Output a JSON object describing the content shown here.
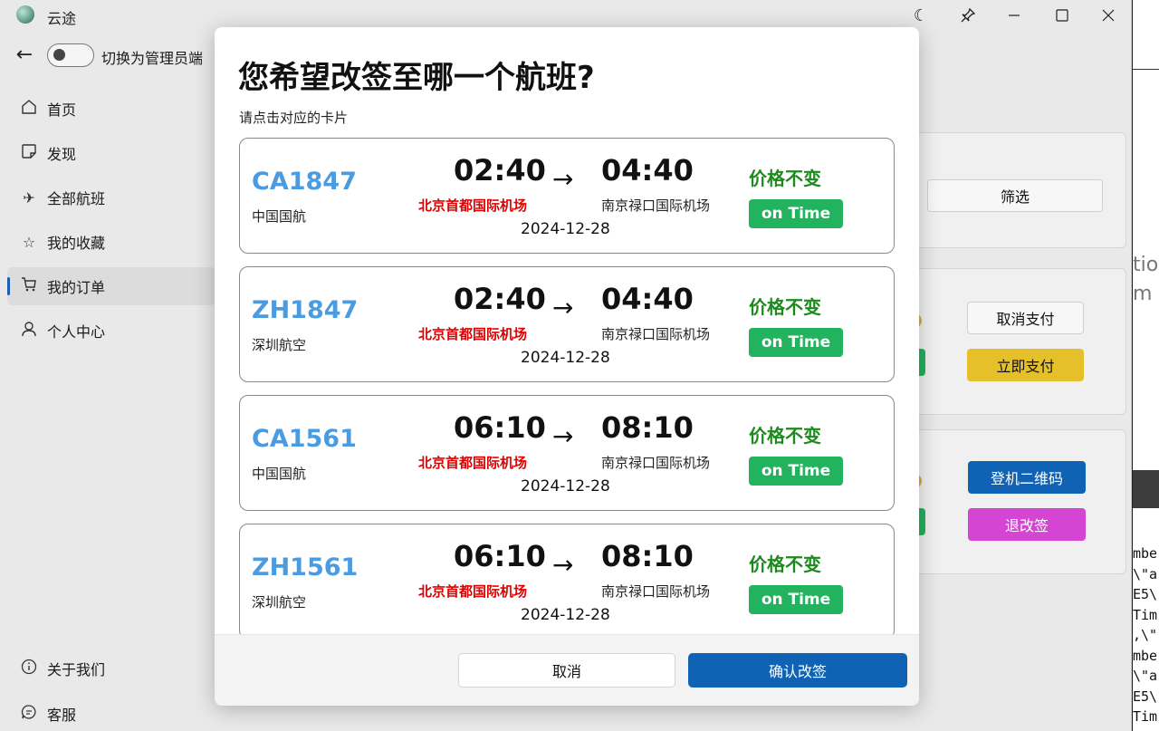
{
  "app": {
    "title": "云途"
  },
  "toggle": {
    "label": "切换为管理员端"
  },
  "nav": {
    "items": [
      {
        "label": "首页",
        "icon": "home-icon"
      },
      {
        "label": "发现",
        "icon": "note-icon"
      },
      {
        "label": "全部航班",
        "icon": "airplane-icon"
      },
      {
        "label": "我的收藏",
        "icon": "star-icon"
      },
      {
        "label": "我的订单",
        "icon": "cart-icon",
        "selected": true
      },
      {
        "label": "个人中心",
        "icon": "person-icon"
      }
    ],
    "bottom": [
      {
        "label": "关于我们",
        "icon": "info-icon"
      },
      {
        "label": "客服",
        "icon": "chat-icon"
      }
    ]
  },
  "background": {
    "filter_label": "筛选",
    "cancel_pay_label": "取消支付",
    "pay_now_label": "立即支付",
    "boarding_qr_label": "登机二维码",
    "refund_change_label": "退改签",
    "terminal_lines": [
      "tio",
      "m",
      "mbe",
      "\\\"a",
      "E5\\",
      "Tim",
      ",\\\"",
      "mbe",
      "\\\"a",
      "E5\\",
      "Tim"
    ]
  },
  "dialog": {
    "title": "您希望改签至哪一个航班?",
    "subtitle": "请点击对应的卡片",
    "arrow": "→",
    "flights": [
      {
        "flight_no": "CA1847",
        "airline": "中国国航",
        "dep_time": "02:40",
        "arr_time": "04:40",
        "dep_airport": "北京首都国际机场",
        "arr_airport": "南京禄口国际机场",
        "date": "2024-12-28",
        "price_note": "价格不变",
        "status": "on Time"
      },
      {
        "flight_no": "ZH1847",
        "airline": "深圳航空",
        "dep_time": "02:40",
        "arr_time": "04:40",
        "dep_airport": "北京首都国际机场",
        "arr_airport": "南京禄口国际机场",
        "date": "2024-12-28",
        "price_note": "价格不变",
        "status": "on Time"
      },
      {
        "flight_no": "CA1561",
        "airline": "中国国航",
        "dep_time": "06:10",
        "arr_time": "08:10",
        "dep_airport": "北京首都国际机场",
        "arr_airport": "南京禄口国际机场",
        "date": "2024-12-28",
        "price_note": "价格不变",
        "status": "on Time"
      },
      {
        "flight_no": "ZH1561",
        "airline": "深圳航空",
        "dep_time": "06:10",
        "arr_time": "08:10",
        "dep_airport": "北京首都国际机场",
        "arr_airport": "南京禄口国际机场",
        "date": "2024-12-28",
        "price_note": "价格不变",
        "status": "on Time"
      }
    ],
    "cancel_label": "取消",
    "confirm_label": "确认改签"
  },
  "colors": {
    "accent": "#0f62b4",
    "flight_no": "#4a9be0",
    "dep_airport": "#e00000",
    "price": "#1b8c1b",
    "status": "#22b35e",
    "pay": "#e6c02a",
    "refund": "#d445d4"
  }
}
